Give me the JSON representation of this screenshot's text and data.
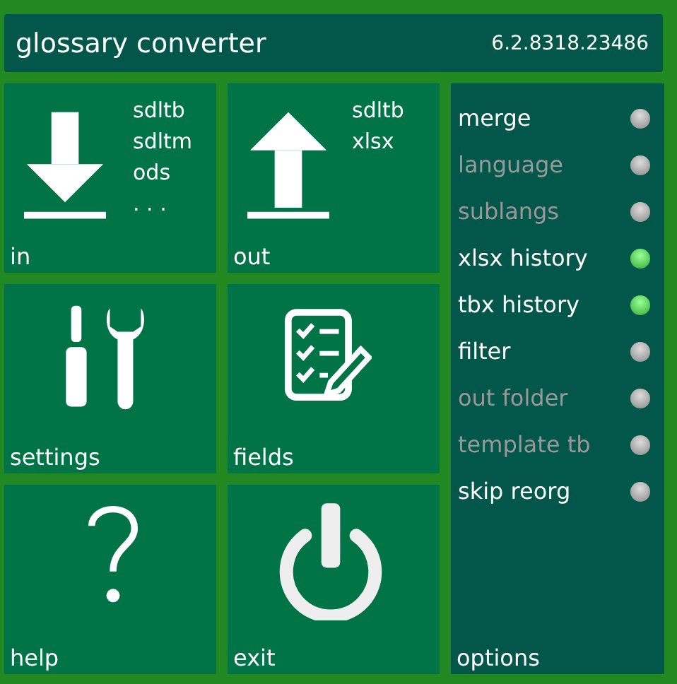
{
  "header": {
    "title": "glossary converter",
    "version": "6.2.8318.23486"
  },
  "tiles": [
    {
      "kind": "download",
      "label": "in",
      "formats": [
        "sdltb",
        "sdltm",
        "ods",
        ". . ."
      ]
    },
    {
      "kind": "upload",
      "label": "out",
      "formats": [
        "sdltb",
        "xlsx"
      ]
    },
    {
      "kind": "tools",
      "label": "settings"
    },
    {
      "kind": "checklist",
      "label": "fields"
    },
    {
      "kind": "help",
      "label": "help"
    },
    {
      "kind": "power",
      "label": "exit"
    }
  ],
  "options": {
    "label": "options",
    "items": [
      {
        "label": "merge",
        "disabled": false,
        "on": false
      },
      {
        "label": "language",
        "disabled": true,
        "on": false
      },
      {
        "label": "sublangs",
        "disabled": true,
        "on": false
      },
      {
        "label": "xlsx history",
        "disabled": false,
        "on": true
      },
      {
        "label": "tbx history",
        "disabled": false,
        "on": true
      },
      {
        "label": "filter",
        "disabled": false,
        "on": false
      },
      {
        "label": "out folder",
        "disabled": true,
        "on": false
      },
      {
        "label": "template tb",
        "disabled": true,
        "on": false
      },
      {
        "label": "skip reorg",
        "disabled": false,
        "on": false
      }
    ]
  }
}
